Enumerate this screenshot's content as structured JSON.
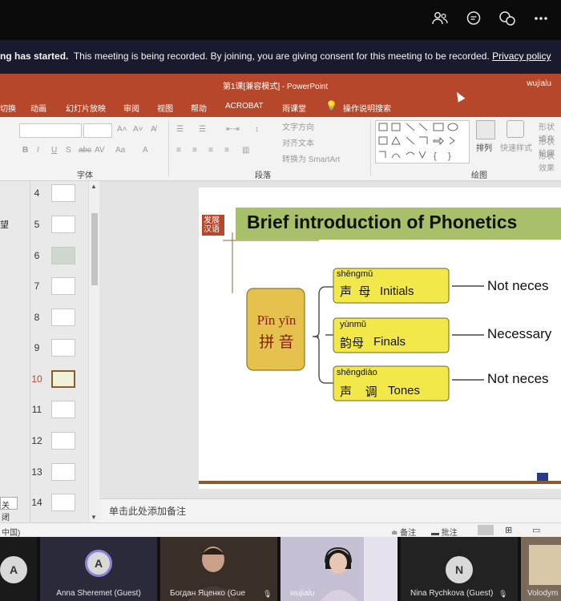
{
  "banner": {
    "bold_text": "ng has started.",
    "text": "This meeting is being recorded. By joining, you are giving consent for this meeting to be recorded.",
    "link": "Privacy policy"
  },
  "titlebar": {
    "title": "第1课[兼容模式] - PowerPoint",
    "user": "wujialu"
  },
  "menu": [
    "切换",
    "动画",
    "幻灯片放映",
    "审阅",
    "视图",
    "帮助",
    "ACROBAT",
    "雨课堂",
    "操作说明搜索"
  ],
  "ribbon": {
    "font_group": "字体",
    "paragraph_group": "段落",
    "drawing_group": "绘图",
    "text_direction": "文字方向",
    "align_text": "对齐文本",
    "smartart": "转换为 SmartArt",
    "arrange": "排列",
    "quick_styles": "快速样式",
    "fill": "形状填充",
    "outline": "形状轮廓",
    "effects": "形状效果"
  },
  "left_strip": {
    "label": "望",
    "close_button": "关闭"
  },
  "thumbnails": [
    "4",
    "5",
    "6",
    "7",
    "8",
    "9",
    "10",
    "11",
    "12",
    "13",
    "14"
  ],
  "selected_slide": "10",
  "slide": {
    "badge_line1": "发展",
    "badge_line2": "汉语",
    "title": "Brief introduction of Phonetics",
    "pinyin_latin": "Pīn yīn",
    "pinyin_han": "拼 音",
    "boxes": [
      {
        "pinyin": "shēngmǔ",
        "han": "声  母",
        "en": "Initials",
        "note": "Not neces"
      },
      {
        "pinyin": "yùnmǔ",
        "han": "韵母",
        "en": "Finals",
        "note": "Necessary"
      },
      {
        "pinyin": "shēngdiào",
        "han": "声    调",
        "en": "Tones",
        "note": "Not neces"
      }
    ]
  },
  "notes_placeholder": "单击此处添加备注",
  "statusbar": {
    "language": "中国)",
    "notes": "备注",
    "comments": "批注"
  },
  "participants": [
    {
      "initial": "A",
      "name": ""
    },
    {
      "initial": "A",
      "name": "Anna Sheremet (Guest)"
    },
    {
      "initial": "",
      "name": "Богдан Яценко (Gue"
    },
    {
      "initial": "",
      "name": "wujialu"
    },
    {
      "initial": "N",
      "name": "Nina Rychkova (Guest)"
    },
    {
      "initial": "",
      "name": "Volodym"
    }
  ],
  "colors": {
    "accent": "#b7472a",
    "slide_box": "#f2e84a",
    "title_band": "#a9c06a",
    "pinyin_box": "#e4c24d"
  }
}
